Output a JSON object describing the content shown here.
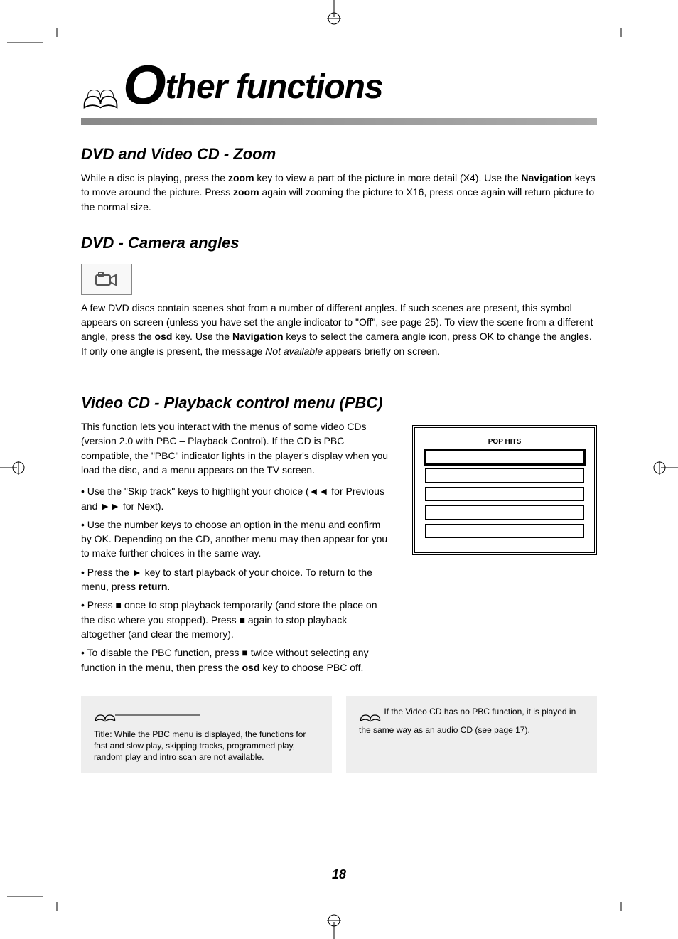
{
  "chapter_title_rest": "ther functions",
  "sections": {
    "zoom": {
      "heading": "DVD and Video CD - Zoom",
      "text_1a": "While a disc is playing, press the ",
      "key_zoom": "zoom",
      "text_1b": " key to view a part of the picture in more detail (X4). Use the ",
      "key_nav": "Navigation",
      "text_1c": " keys to move around the picture. Press ",
      "text_1d": " again will zooming the picture to X16, press once again will return picture to the normal size."
    },
    "angles": {
      "heading": "DVD - Camera angles",
      "p1a": "A few DVD discs contain scenes shot from a number of different angles. If such scenes are present, this symbol appears on screen (unless you have set the angle indicator to \"Off\", see page 25). To view the scene from a different angle, press the ",
      "key_osd": "osd",
      "text_osd_suffix": " key. Use the ",
      "key_nav": "Navigation",
      "text_1c": " keys to select the camera angle icon, press OK to change the angles. If only one angle is present, the message ",
      "not_avail": "Not available",
      "text_1d": " appears briefly on screen."
    },
    "pbc": {
      "heading": "Video CD - Playback control menu (PBC)",
      "intro": "This function lets you interact with the menus of some video CDs (version 2.0 with PBC – Playback Control). If the CD is PBC compatible, the \"PBC\" indicator lights in the player's display when you load the disc, and a menu appears on the TV screen.",
      "b1_a": "Use the \"Skip track\" keys to highlight your choice (",
      "b1_b": " for Previous and ",
      "b1_c": " for Next).",
      "b2": "Use the number keys to choose an option in the menu and confirm by OK. Depending on the CD, another menu may then appear for you to make further choices in the same way.",
      "b3_a": "Press the ",
      "b3_b": " key to start playback of your choice. To return to the menu, press ",
      "key_return": "return",
      "b3_c": ".",
      "b4_a": "Press ",
      "b4_b": " once to stop playback temporarily (and store the place on the disc where you stopped). Press ",
      "b4_c": " again to stop playback altogether (and clear the memory).",
      "b5_a": "To disable the PBC function, press ",
      "b5_b": " twice without selecting any function in the menu, then press the ",
      "b5_c": " key to choose PBC off.",
      "menu": {
        "title": "POP HITS",
        "rows": [
          "",
          "",
          "",
          "",
          ""
        ],
        "footer": ""
      },
      "note1": "Title: While the PBC menu is displayed, the functions for fast and slow play, skipping tracks, programmed play, random play and intro scan are not available.",
      "note2": "If the Video CD has no PBC function, it is played in the same way as an audio CD (see page 17)."
    }
  },
  "page_number": "18"
}
